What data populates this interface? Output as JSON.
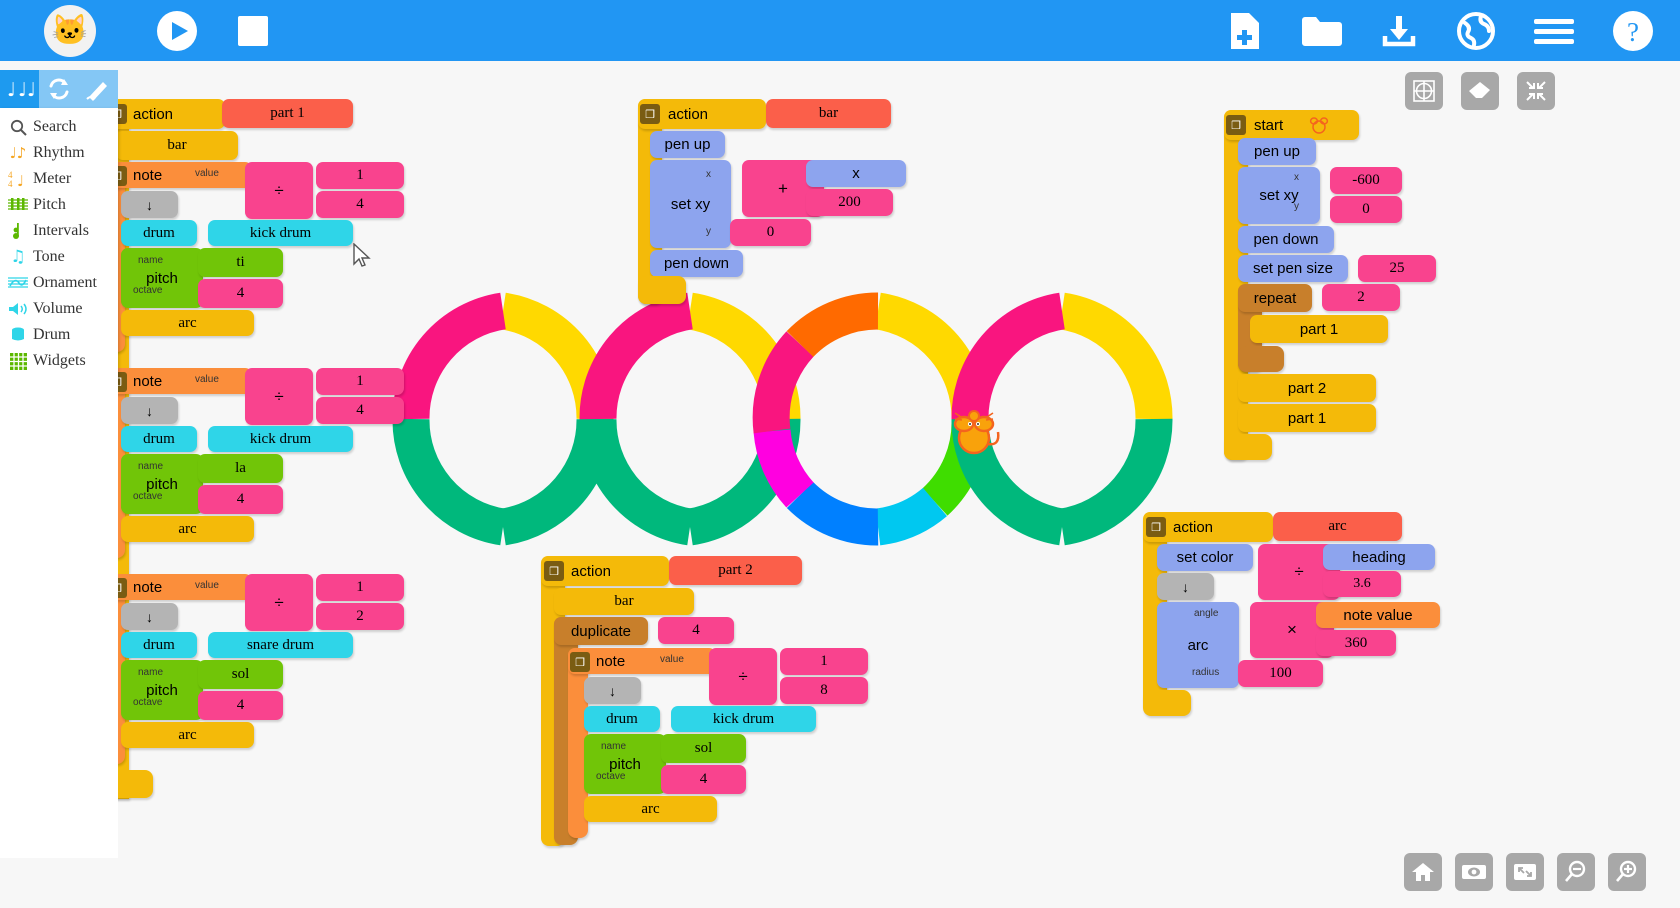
{
  "app": {
    "title": "Music Blocks",
    "logo_icon": "cat-logo-icon"
  },
  "toolbar": {
    "play_label": "Play",
    "stop_label": "Stop",
    "new_label": "New project",
    "open_label": "Open",
    "save_label": "Save / download",
    "planet_label": "Planet",
    "menu_label": "Menu",
    "help_label": "Help"
  },
  "palette": {
    "tabs": [
      {
        "name": "notes-tab",
        "icon": "notes-icon",
        "active": true
      },
      {
        "name": "refresh-tab",
        "icon": "refresh-icon",
        "active": false
      },
      {
        "name": "pen-tab",
        "icon": "pencil-icon",
        "active": false
      }
    ],
    "items": [
      {
        "label": "Search",
        "icon": "search-icon"
      },
      {
        "label": "Rhythm",
        "icon": "rhythm-icon"
      },
      {
        "label": "Meter",
        "icon": "meter-icon"
      },
      {
        "label": "Pitch",
        "icon": "pitch-icon"
      },
      {
        "label": "Intervals",
        "icon": "intervals-icon"
      },
      {
        "label": "Tone",
        "icon": "tone-icon"
      },
      {
        "label": "Ornament",
        "icon": "ornament-icon"
      },
      {
        "label": "Volume",
        "icon": "volume-icon"
      },
      {
        "label": "Drum",
        "icon": "drum-icon"
      },
      {
        "label": "Widgets",
        "icon": "widgets-icon"
      }
    ]
  },
  "canvas_controls": {
    "top_right": [
      {
        "label": "Show grid",
        "icon": "grid-icon"
      },
      {
        "label": "Clear",
        "icon": "eraser-icon"
      },
      {
        "label": "Collapse",
        "icon": "collapse-icon"
      }
    ],
    "bottom_right": [
      {
        "label": "Home",
        "icon": "home-icon"
      },
      {
        "label": "Show/hide blocks",
        "icon": "eye-icon"
      },
      {
        "label": "Expand",
        "icon": "expand-icon"
      },
      {
        "label": "Zoom out",
        "icon": "zoom-out-icon"
      },
      {
        "label": "Zoom in",
        "icon": "zoom-in-icon"
      }
    ]
  },
  "colors": {
    "toolbar": "#2196f3",
    "action": "#f4ba09",
    "action_name": "#fb5f4a",
    "note": "#fb8e3b",
    "pitch": "#71c508",
    "drum": "#2fd5e8",
    "number": "#f9438e",
    "pen": "#8da4ee",
    "flow": "#c87f2b",
    "rest": "#b4b4b4",
    "note_value": "#fb8e3b"
  },
  "blocks": {
    "part1": {
      "action_label": "action",
      "name_label": "part 1",
      "bar_label": "bar",
      "notes": [
        {
          "note_label": "note",
          "value_param": "value",
          "divide_glyph": "÷",
          "numerator": "1",
          "denominator": "4",
          "rest_glyph": "↓",
          "drum_label": "drum",
          "drum_value": "kick drum",
          "pitch_label": "pitch",
          "name_param": "name",
          "pitch_name": "ti",
          "octave_param": "octave",
          "octave_value": "4",
          "arc_label": "arc"
        },
        {
          "note_label": "note",
          "value_param": "value",
          "divide_glyph": "÷",
          "numerator": "1",
          "denominator": "4",
          "rest_glyph": "↓",
          "drum_label": "drum",
          "drum_value": "kick drum",
          "pitch_label": "pitch",
          "name_param": "name",
          "pitch_name": "la",
          "octave_param": "octave",
          "octave_value": "4",
          "arc_label": "arc"
        },
        {
          "note_label": "note",
          "value_param": "value",
          "divide_glyph": "÷",
          "numerator": "1",
          "denominator": "2",
          "rest_glyph": "↓",
          "drum_label": "drum",
          "drum_value": "snare drum",
          "pitch_label": "pitch",
          "name_param": "name",
          "pitch_name": "sol",
          "octave_param": "octave",
          "octave_value": "4",
          "arc_label": "arc"
        }
      ]
    },
    "bar_action": {
      "action_label": "action",
      "name_label": "bar",
      "pen_up_label": "pen up",
      "set_xy_label": "set xy",
      "x_param": "x",
      "y_param": "y",
      "plus_glyph": "+",
      "x_box_label": "x",
      "x_add_value": "200",
      "y_value": "0",
      "pen_down_label": "pen down"
    },
    "start": {
      "start_label": "start",
      "turtle_icon": "mouse-icon",
      "pen_up_label": "pen up",
      "set_xy_label": "set xy",
      "x_param": "x",
      "y_param": "y",
      "x_value": "-600",
      "y_value": "0",
      "pen_down_label": "pen down",
      "set_pen_size_label": "set pen size",
      "pen_size_value": "25",
      "repeat_label": "repeat",
      "repeat_value": "2",
      "repeat_body": "part 1",
      "after_1": "part 2",
      "after_2": "part 1"
    },
    "part2": {
      "action_label": "action",
      "name_label": "part 2",
      "bar_label": "bar",
      "duplicate_label": "duplicate",
      "duplicate_value": "4",
      "note_label": "note",
      "value_param": "value",
      "divide_glyph": "÷",
      "numerator": "1",
      "denominator": "8",
      "rest_glyph": "↓",
      "drum_label": "drum",
      "drum_value": "kick drum",
      "pitch_label": "pitch",
      "name_param": "name",
      "pitch_name": "sol",
      "octave_param": "octave",
      "octave_value": "4",
      "arc_label": "arc"
    },
    "arc_action": {
      "action_label": "action",
      "name_label": "arc",
      "set_color_label": "set color",
      "divide_glyph": "÷",
      "heading_label": "heading",
      "heading_divisor": "3.6",
      "rest_glyph": "↓",
      "arc_label": "arc",
      "angle_param": "angle",
      "multiply_glyph": "×",
      "note_value_label": "note value",
      "degrees_value": "360",
      "radius_param": "radius",
      "radius_value": "100"
    }
  },
  "artwork": {
    "description": "four overlapping rings drawn by the turtle",
    "ring_colors": [
      "#f9157f",
      "#ffd900",
      "#00b87c",
      "#ff6a00",
      "#ff00e0",
      "#0080ff",
      "#00c8f0",
      "#3fdd00"
    ],
    "sprite": "mouse-sprite"
  }
}
